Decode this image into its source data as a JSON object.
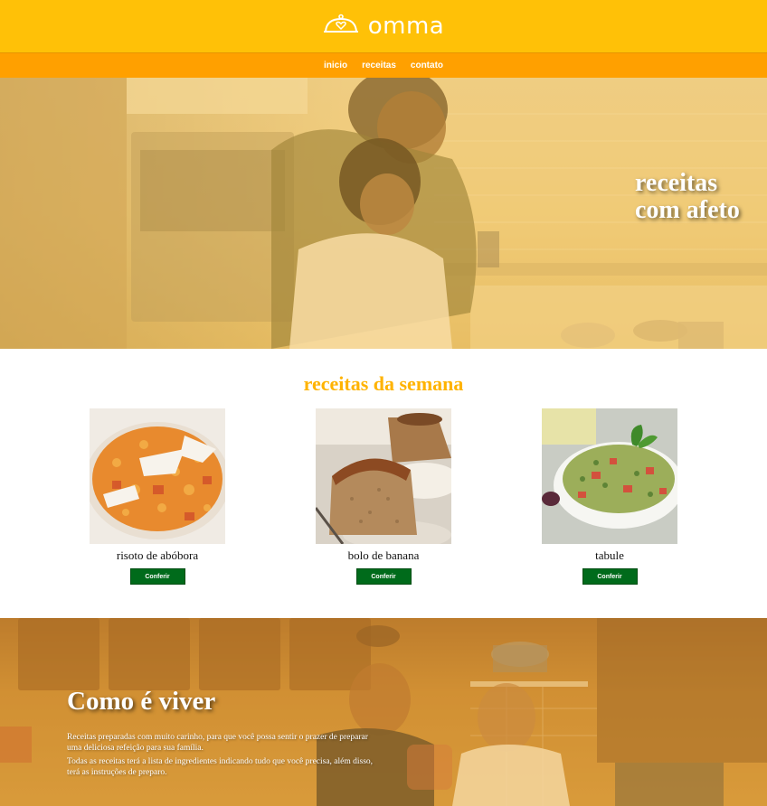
{
  "header": {
    "brand": "omma",
    "logo_icon": "cloche-heart-icon",
    "colors": {
      "topbar": "#ffc107",
      "navbar": "#ffa000"
    }
  },
  "nav": {
    "items": [
      {
        "label": "inicio"
      },
      {
        "label": "receitas"
      },
      {
        "label": "contato"
      }
    ]
  },
  "hero": {
    "title_line1": "receitas",
    "title_line2": "com afeto"
  },
  "weekly": {
    "title": "receitas da semana",
    "recipes": [
      {
        "name": "risoto de abóbora",
        "button": "Conferir"
      },
      {
        "name": "bolo de banana",
        "button": "Conferir"
      },
      {
        "name": "tabule",
        "button": "Conferir"
      }
    ]
  },
  "about": {
    "title": "Como é viver",
    "paragraph1": "Receitas preparadas com muito carinho, para que você possa sentir o prazer de preparar uma deliciosa refeição para sua família.",
    "paragraph2": "Todas as receitas terá a lista de ingredientes indicando tudo que você precisa, além disso, terá as instruções de preparo."
  },
  "colors": {
    "accent": "#ffb300",
    "button": "#006b1b"
  }
}
